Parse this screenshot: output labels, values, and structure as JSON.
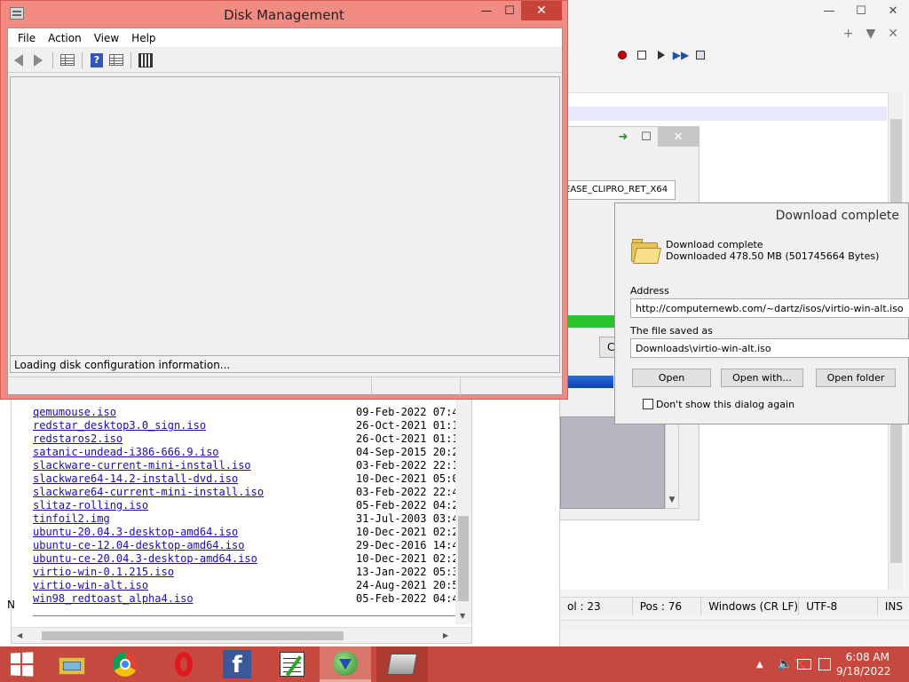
{
  "disk_management": {
    "title": "Disk Management",
    "menu": [
      "File",
      "Action",
      "View",
      "Help"
    ],
    "status_text": "Loading disk configuration information..."
  },
  "editor": {
    "status": {
      "col": "ol : 23",
      "pos": "Pos : 76",
      "eol": "Windows (CR LF)",
      "encoding": "UTF-8",
      "mode": "INS"
    },
    "left_fragment": "N"
  },
  "background_dialog": {
    "field_text": "EASE_CLIPRO_RET_X64",
    "button_fragment": "C"
  },
  "download_dialog": {
    "title": "Download complete",
    "line1": "Download complete",
    "line2": "Downloaded 478.50  MB (501745664 Bytes)",
    "address_label": "Address",
    "address_value": "http://computernewb.com/~dartz/isos/virtio-win-alt.iso",
    "saved_label": "The file saved as",
    "saved_value": "Downloads\\virtio-win-alt.iso",
    "open_button": "Open",
    "open_with_button": "Open with...",
    "open_folder_button": "Open folder",
    "dont_show": "Don't show this dialog again"
  },
  "listing": {
    "rows": [
      {
        "name": "qemumouse.iso",
        "date": "09-Feb-2022 07:4"
      },
      {
        "name": "redstar_desktop3.0_sign.iso",
        "date": "26-Oct-2021 01:1"
      },
      {
        "name": "redstaros2.iso",
        "date": "26-Oct-2021 01:1"
      },
      {
        "name": "satanic-undead-i386-666.9.iso",
        "date": "04-Sep-2015 20:2"
      },
      {
        "name": "slackware-current-mini-install.iso",
        "date": "03-Feb-2022 22:1"
      },
      {
        "name": "slackware64-14.2-install-dvd.iso",
        "date": "10-Dec-2021 05:0"
      },
      {
        "name": "slackware64-current-mini-install.iso",
        "date": "03-Feb-2022 22:4"
      },
      {
        "name": "slitaz-rolling.iso",
        "date": "05-Feb-2022 04:2"
      },
      {
        "name": "tinfoil2.img",
        "date": "31-Jul-2003 03:4"
      },
      {
        "name": "ubuntu-20.04.3-desktop-amd64.iso",
        "date": "10-Dec-2021 02:2"
      },
      {
        "name": "ubuntu-ce-12.04-desktop-amd64.iso",
        "date": "29-Dec-2016 14:4"
      },
      {
        "name": "ubuntu-ce-20.04.3-desktop-amd64.iso",
        "date": "10-Dec-2021 02:2"
      },
      {
        "name": "virtio-win-0.1.215.iso",
        "date": "13-Jan-2022 05:3"
      },
      {
        "name": "virtio-win-alt.iso",
        "date": "24-Aug-2021 20:5"
      },
      {
        "name": "win98_redtoast_alpha4.iso",
        "date": "05-Feb-2022 04:4"
      }
    ]
  },
  "taskbar": {
    "time": "6:08 AM",
    "date": "9/18/2022"
  }
}
